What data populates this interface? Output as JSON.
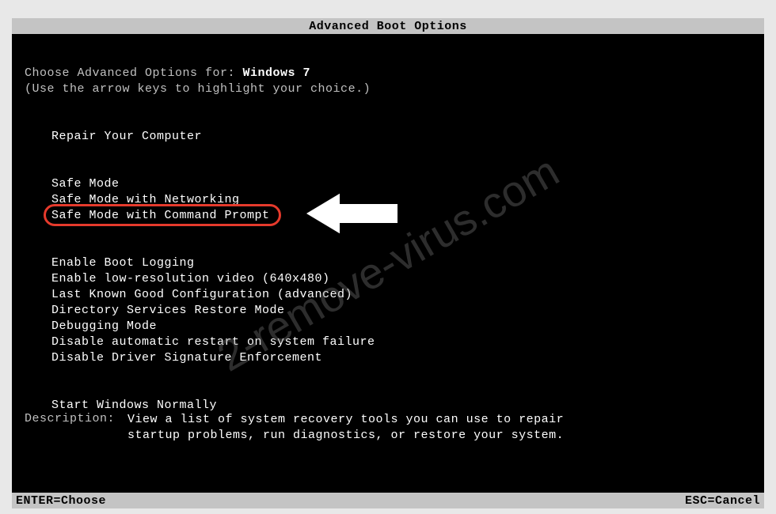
{
  "title": "Advanced Boot Options",
  "instruction": {
    "line1_prefix": "Choose Advanced Options for: ",
    "os": "Windows 7",
    "line2": "(Use the arrow keys to highlight your choice.)"
  },
  "options": {
    "repair": "Repair Your Computer",
    "safe_mode": "Safe Mode",
    "safe_mode_net": "Safe Mode with Networking",
    "safe_mode_cmd": "Safe Mode with Command Prompt",
    "boot_log": "Enable Boot Logging",
    "low_res": "Enable low-resolution video (640x480)",
    "last_known": "Last Known Good Configuration (advanced)",
    "ds_restore": "Directory Services Restore Mode",
    "debug": "Debugging Mode",
    "no_auto_restart": "Disable automatic restart on system failure",
    "no_sig_enforce": "Disable Driver Signature Enforcement",
    "start_normal": "Start Windows Normally"
  },
  "description": {
    "label": "Description:",
    "text": "View a list of system recovery tools you can use to repair startup problems, run diagnostics, or restore your system."
  },
  "footer": {
    "enter": "ENTER=Choose",
    "esc": "ESC=Cancel"
  },
  "watermark": "2-remove-virus.com",
  "highlight_color": "#e63a2c",
  "arrow_color": "#ffffff"
}
